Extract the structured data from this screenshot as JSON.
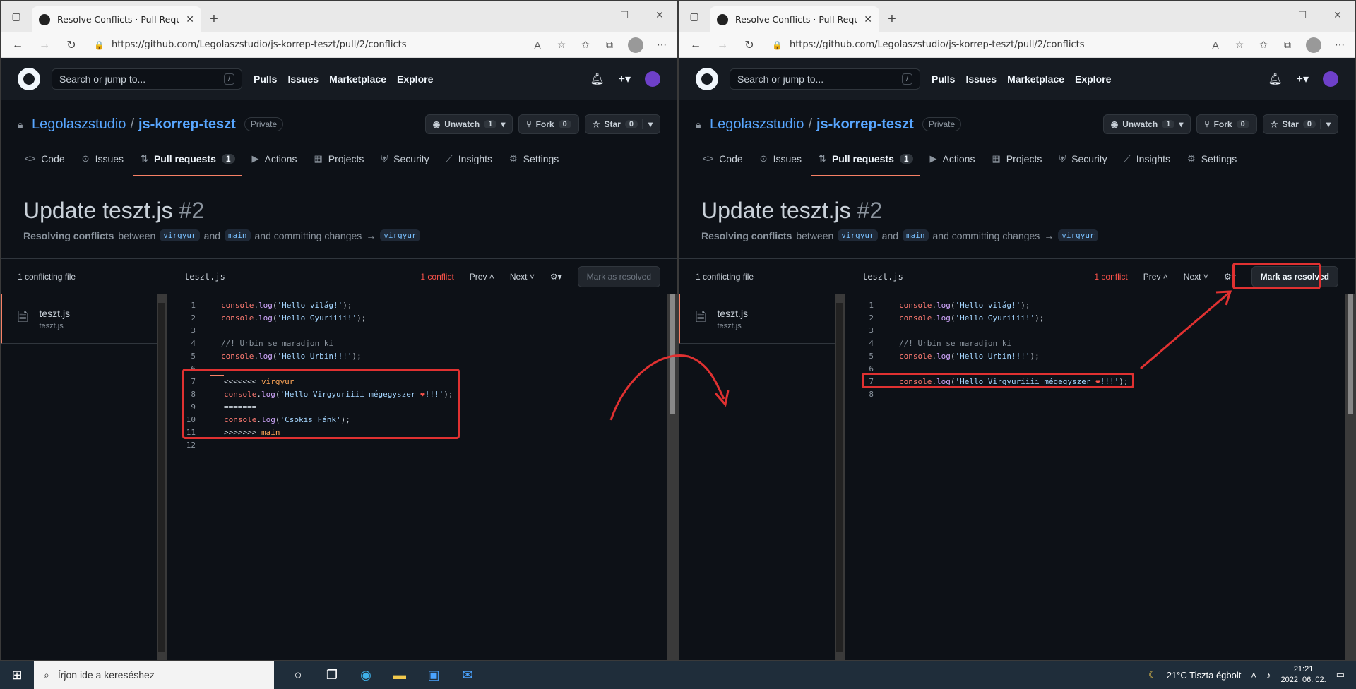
{
  "browser": {
    "tab_title": "Resolve Conflicts · Pull Request #",
    "url": "https://github.com/Legolaszstudio/js-korrep-teszt/pull/2/conflicts"
  },
  "github": {
    "search_placeholder": "Search or jump to...",
    "nav": [
      "Pulls",
      "Issues",
      "Marketplace",
      "Explore"
    ],
    "owner": "Legolaszstudio",
    "sep": "/",
    "repo": "js-korrep-teszt",
    "visibility": "Private",
    "unwatch": {
      "label": "Unwatch",
      "count": "1"
    },
    "fork": {
      "label": "Fork",
      "count": "0"
    },
    "star": {
      "label": "Star",
      "count": "0"
    },
    "tabs": [
      {
        "label": "Code",
        "icon": "code-icon"
      },
      {
        "label": "Issues",
        "icon": "issue-icon"
      },
      {
        "label": "Pull requests",
        "icon": "pull-request-icon",
        "badge": "1"
      },
      {
        "label": "Actions",
        "icon": "play-icon"
      },
      {
        "label": "Projects",
        "icon": "table-icon"
      },
      {
        "label": "Security",
        "icon": "shield-icon"
      },
      {
        "label": "Insights",
        "icon": "graph-icon"
      },
      {
        "label": "Settings",
        "icon": "gear-icon"
      }
    ]
  },
  "pr": {
    "title": "Update teszt.js",
    "number": "#2",
    "sub_resolving": "Resolving conflicts",
    "sub_between": "between",
    "head_branch": "virgyur",
    "sub_and": "and",
    "base_branch": "main",
    "sub_committing": "and committing changes",
    "arrow": "→",
    "target_branch": "virgyur"
  },
  "editor": {
    "conflicting_files": "1 conflicting file",
    "file_name": "teszt.js",
    "file_path": "teszt.js",
    "conflict_count": "1 conflict",
    "prev": "Prev",
    "next": "Next",
    "mark_resolved": "Mark as resolved"
  },
  "code_left": [
    {
      "n": "1",
      "t": "console.log('Hello világ!');"
    },
    {
      "n": "2",
      "t": "console.log('Hello Gyuriiii!');"
    },
    {
      "n": "3",
      "t": ""
    },
    {
      "n": "4",
      "t": "//! Urbin se maradjon ki"
    },
    {
      "n": "5",
      "t": "console.log('Hello Urbin!!!');"
    },
    {
      "n": "6",
      "t": ""
    },
    {
      "n": "7",
      "t": "<<<<<<< virgyur"
    },
    {
      "n": "8",
      "t": "console.log('Hello Virgyuriiii mégegyszer ❤!!!');"
    },
    {
      "n": "9",
      "t": "======="
    },
    {
      "n": "10",
      "t": "console.log('Csokis Fánk');"
    },
    {
      "n": "11",
      "t": ">>>>>>> main"
    },
    {
      "n": "12",
      "t": ""
    }
  ],
  "code_right": [
    {
      "n": "1",
      "t": "console.log('Hello világ!');"
    },
    {
      "n": "2",
      "t": "console.log('Hello Gyuriiii!');"
    },
    {
      "n": "3",
      "t": ""
    },
    {
      "n": "4",
      "t": "//! Urbin se maradjon ki"
    },
    {
      "n": "5",
      "t": "console.log('Hello Urbin!!!');"
    },
    {
      "n": "6",
      "t": ""
    },
    {
      "n": "7",
      "t": "console.log('Hello Virgyuriiii mégegyszer ❤!!!');"
    },
    {
      "n": "8",
      "t": ""
    }
  ],
  "taskbar": {
    "search_placeholder": "Írjon ide a kereséshez",
    "weather": "21°C  Tiszta égbolt",
    "time": "21:21",
    "date": "2022. 06. 02."
  },
  "colors": {
    "highlight": "#e03131",
    "accent": "#f78166",
    "link": "#58a6ff"
  }
}
